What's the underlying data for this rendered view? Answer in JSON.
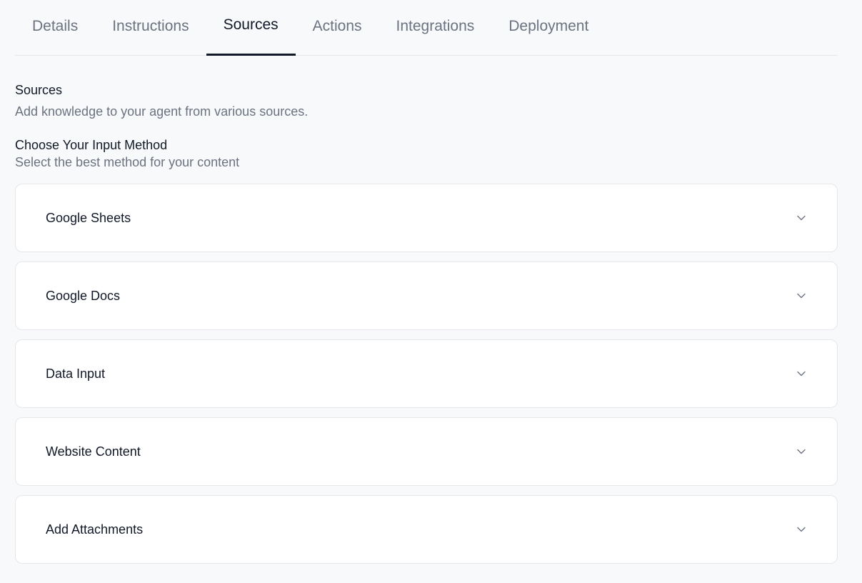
{
  "tabs": [
    {
      "label": "Details",
      "active": false
    },
    {
      "label": "Instructions",
      "active": false
    },
    {
      "label": "Sources",
      "active": true
    },
    {
      "label": "Actions",
      "active": false
    },
    {
      "label": "Integrations",
      "active": false
    },
    {
      "label": "Deployment",
      "active": false
    }
  ],
  "sources": {
    "title": "Sources",
    "description": "Add knowledge to your agent from various sources."
  },
  "input_method": {
    "title": "Choose Your Input Method",
    "description": "Select the best method for your content"
  },
  "methods": [
    {
      "label": "Google Sheets",
      "icon": "chevron-down-icon"
    },
    {
      "label": "Google Docs",
      "icon": "chevron-down-icon"
    },
    {
      "label": "Data Input",
      "icon": "chevron-down-icon"
    },
    {
      "label": "Website Content",
      "icon": "chevron-down-icon"
    },
    {
      "label": "Add Attachments",
      "icon": "chevron-down-icon"
    }
  ],
  "colors": {
    "background": "#f8f9fb",
    "active_tab": "#111827",
    "inactive_tab": "#6b7280",
    "card_border": "#e5e7eb"
  }
}
